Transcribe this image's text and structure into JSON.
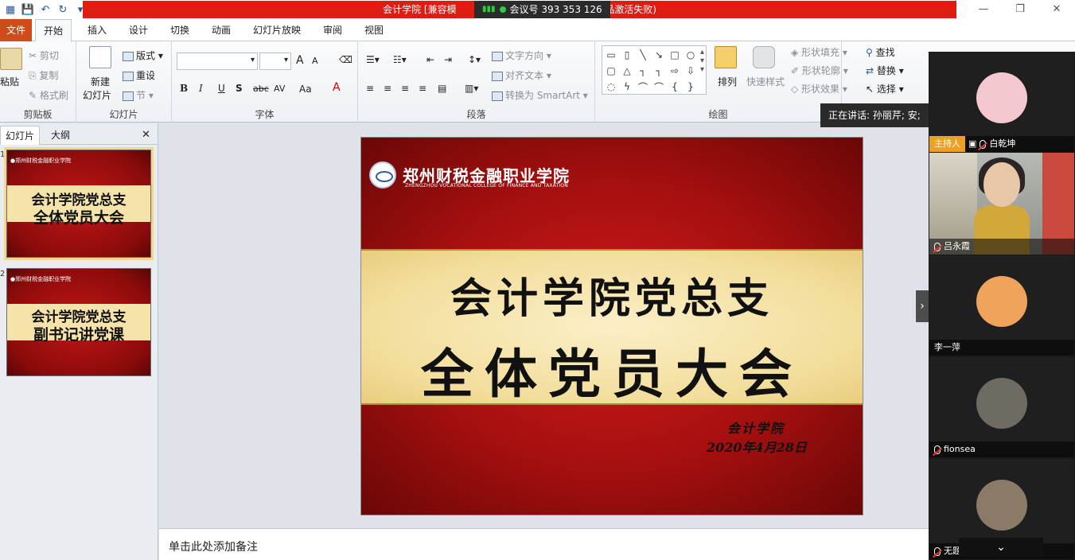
{
  "window": {
    "title": "会计学院 [兼容模",
    "title_tail": "nt(产品激活失败)",
    "meeting_id": "会议号 393 353 126",
    "controls": [
      "—",
      "❐",
      "✕"
    ]
  },
  "tabs": {
    "file": "文件",
    "items": [
      "开始",
      "插入",
      "设计",
      "切换",
      "动画",
      "幻灯片放映",
      "审阅",
      "视图"
    ],
    "active": "开始"
  },
  "ribbon": {
    "clipboard": {
      "paste": "粘贴",
      "cut": "剪切",
      "copy": "复制",
      "format_painter": "格式刷",
      "label": "剪贴板"
    },
    "slides": {
      "new_slide_1": "新建",
      "new_slide_2": "幻灯片",
      "layout": "版式",
      "reset": "重设",
      "section": "节",
      "label": "幻灯片"
    },
    "font": {
      "font_name": "",
      "font_size": "",
      "bold": "B",
      "italic": "I",
      "underline": "U",
      "strike": "abc",
      "spacing": "AV",
      "case": "Aa",
      "color": "A",
      "grow": "A",
      "shrink": "A",
      "label": "字体"
    },
    "paragraph": {
      "text_direction": "文字方向",
      "align_text": "对齐文本",
      "smartart": "转换为 SmartArt",
      "label": "段落"
    },
    "drawing": {
      "arrange": "排列",
      "quick_styles": "快速样式",
      "shape_fill": "形状填充",
      "shape_outline": "形状轮廓",
      "shape_effects": "形状效果",
      "label": "绘图"
    },
    "editing": {
      "find": "查找",
      "replace": "替换",
      "select": "选择"
    }
  },
  "left_panel": {
    "tab_slides": "幻灯片",
    "tab_outline": "大纲",
    "close": "✕",
    "thumbs": [
      {
        "num": "1",
        "line1": "会计学院党总支",
        "line2": "全体党员大会"
      },
      {
        "num": "2",
        "line1": "会计学院党总支",
        "line2": "副书记讲党课"
      }
    ]
  },
  "slide": {
    "school_cn": "郑州财税金融职业学院",
    "school_en": "ZHENGZHOU VOCATIONAL COLLEGE OF FINANCE AND TAXATION",
    "title_line1": "会计学院党总支",
    "title_line2": "全体党员大会",
    "department": "会计学院",
    "date": "2020年4月28日"
  },
  "notes": {
    "placeholder": "单击此处添加备注"
  },
  "meeting": {
    "speaking": "正在讲话: 孙丽芹; 安;",
    "host_badge": "主持人",
    "participants": [
      {
        "name": "白乾坤",
        "avatar_color": "#f3c9cf"
      },
      {
        "name": "吕永霞",
        "avatar_color": "#e8c6a8"
      },
      {
        "name": "李一萍",
        "avatar_color": "#f0a35a"
      },
      {
        "name": "fionsea",
        "avatar_color": "#6e6b63"
      },
      {
        "name": "无题",
        "avatar_color": "#8b7a65"
      }
    ],
    "collapse": "⌄"
  }
}
